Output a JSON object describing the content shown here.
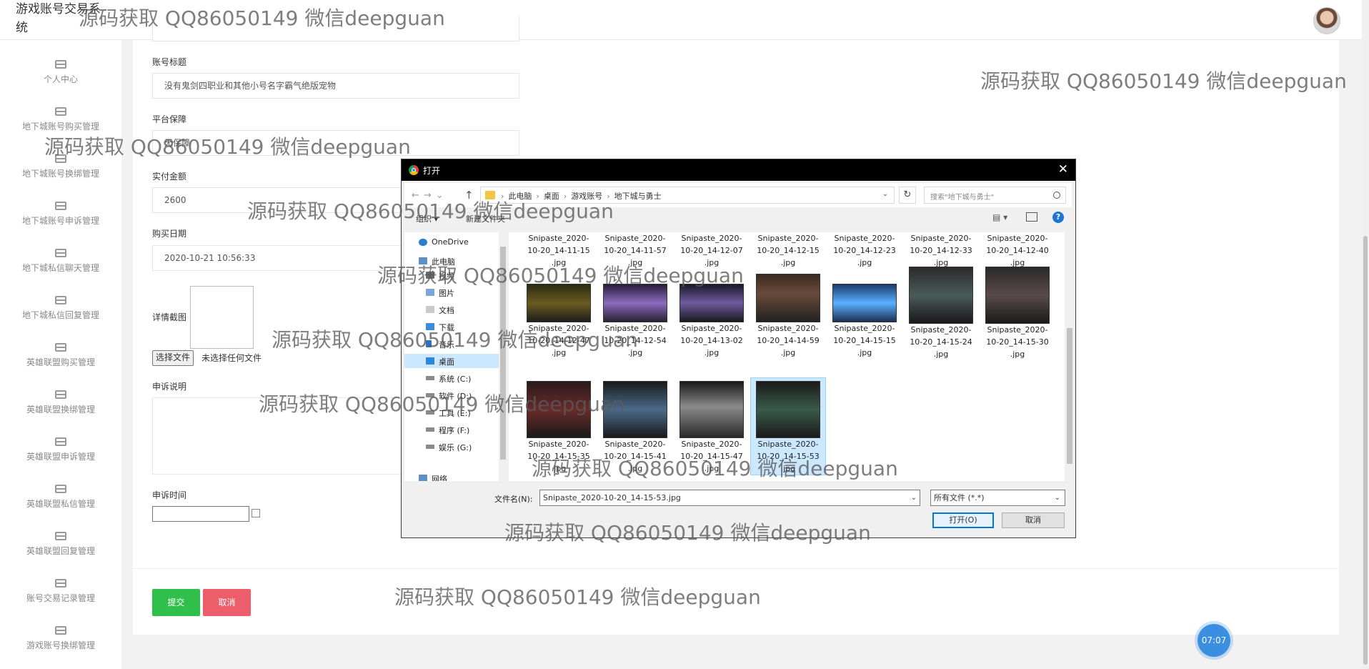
{
  "app": {
    "title": "游戏账号交易系统"
  },
  "sidebar": {
    "items": [
      {
        "label": "个人中心"
      },
      {
        "label": "地下城账号购买管理"
      },
      {
        "label": "地下城账号换绑管理"
      },
      {
        "label": "地下城账号申诉管理"
      },
      {
        "label": "地下城私信聊天管理"
      },
      {
        "label": "地下城私信回复管理"
      },
      {
        "label": "英雄联盟购买管理"
      },
      {
        "label": "英雄联盟换绑管理"
      },
      {
        "label": "英雄联盟申诉管理"
      },
      {
        "label": "英雄联盟私信管理"
      },
      {
        "label": "英雄联盟回复管理"
      },
      {
        "label": "账号交易记录管理"
      },
      {
        "label": "游戏账号换绑管理"
      }
    ]
  },
  "form": {
    "account_title_label": "账号标题",
    "account_title_value": "没有鬼剑四职业和其他小号名字霸气绝版宠物",
    "platform_label": "平台保障",
    "platform_value": "无保障",
    "amount_label": "实付金额",
    "amount_value": "2600",
    "date_label": "购买日期",
    "date_value": "2020-10-21 10:56:33",
    "screenshot_label": "详情截图",
    "choose_file": "选择文件",
    "no_file": "未选择任何文件",
    "appeal_desc_label": "申诉说明",
    "appeal_time_label": "申诉时间",
    "submit": "提交",
    "cancel": "取消"
  },
  "timer": "07:07",
  "dialog": {
    "title": "打开",
    "breadcrumbs": [
      "此电脑",
      "桌面",
      "游戏账号",
      "地下城与勇士"
    ],
    "search_placeholder": "搜索\"地下城与勇士\"",
    "organize": "组织 ▾",
    "new_folder": "新建文件夹",
    "nav_items": [
      {
        "label": "OneDrive",
        "selected": false
      },
      {
        "label": "此电脑",
        "selected": false
      },
      {
        "label": "视频",
        "selected": false
      },
      {
        "label": "图片",
        "selected": false
      },
      {
        "label": "文档",
        "selected": false
      },
      {
        "label": "下载",
        "selected": false
      },
      {
        "label": "音乐",
        "selected": false
      },
      {
        "label": "桌面",
        "selected": true
      },
      {
        "label": "系统 (C:)",
        "selected": false
      },
      {
        "label": "软件 (D:)",
        "selected": false
      },
      {
        "label": "工具 (E:)",
        "selected": false
      },
      {
        "label": "程序 (F:)",
        "selected": false
      },
      {
        "label": "娱乐 (G:)",
        "selected": false
      },
      {
        "label": "网络",
        "selected": false
      }
    ],
    "files_row1": [
      {
        "l1": "Snipaste_2020-",
        "l2": "10-20_14-11-15",
        "l3": ".jpg"
      },
      {
        "l1": "Snipaste_2020-",
        "l2": "10-20_14-11-57",
        "l3": ".jpg"
      },
      {
        "l1": "Snipaste_2020-",
        "l2": "10-20_14-12-07",
        "l3": ".jpg"
      },
      {
        "l1": "Snipaste_2020-",
        "l2": "10-20_14-12-15",
        "l3": ".jpg"
      },
      {
        "l1": "Snipaste_2020-",
        "l2": "10-20_14-12-23",
        "l3": ".jpg"
      },
      {
        "l1": "Snipaste_2020-",
        "l2": "10-20_14-12-33",
        "l3": ".jpg"
      },
      {
        "l1": "Snipaste_2020-",
        "l2": "10-20_14-12-40",
        "l3": ".jpg"
      }
    ],
    "files_row2": [
      {
        "l1": "Snipaste_2020-",
        "l2": "10-20_14-12-47",
        "l3": ".jpg"
      },
      {
        "l1": "Snipaste_2020-",
        "l2": "10-20_14-12-54",
        "l3": ".jpg"
      },
      {
        "l1": "Snipaste_2020-",
        "l2": "10-20_14-13-02",
        "l3": ".jpg"
      },
      {
        "l1": "Snipaste_2020-",
        "l2": "10-20_14-14-59",
        "l3": ".jpg"
      },
      {
        "l1": "Snipaste_2020-",
        "l2": "10-20_14-15-15",
        "l3": ".jpg"
      },
      {
        "l1": "Snipaste_2020-",
        "l2": "10-20_14-15-24",
        "l3": ".jpg"
      },
      {
        "l1": "Snipaste_2020-",
        "l2": "10-20_14-15-30",
        "l3": ".jpg"
      }
    ],
    "files_row3": [
      {
        "l1": "Snipaste_2020-",
        "l2": "10-20_14-15-35",
        "l3": ".jpg"
      },
      {
        "l1": "Snipaste_2020-",
        "l2": "10-20_14-15-41",
        "l3": ".jpg"
      },
      {
        "l1": "Snipaste_2020-",
        "l2": "10-20_14-15-47",
        "l3": ".jpg"
      },
      {
        "l1": "Snipaste_2020-",
        "l2": "10-20_14-15-53",
        "l3": ".jpg"
      }
    ],
    "filename_label": "文件名(N):",
    "filename_value": "Snipaste_2020-10-20_14-15-53.jpg",
    "filetype_value": "所有文件 (*.*)",
    "open_button": "打开(O)",
    "cancel_button": "取消"
  },
  "watermark": "源码获取 QQ86050149 微信deepguan"
}
